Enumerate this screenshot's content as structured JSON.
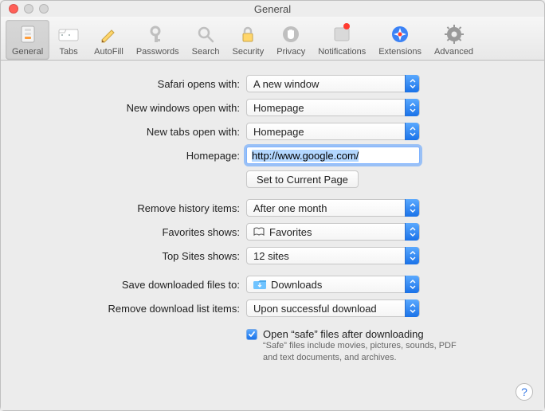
{
  "window": {
    "title": "General"
  },
  "toolbar": {
    "items": [
      {
        "name": "general",
        "label": "General",
        "selected": true
      },
      {
        "name": "tabs",
        "label": "Tabs"
      },
      {
        "name": "autofill",
        "label": "AutoFill"
      },
      {
        "name": "passwords",
        "label": "Passwords"
      },
      {
        "name": "search",
        "label": "Search"
      },
      {
        "name": "security",
        "label": "Security"
      },
      {
        "name": "privacy",
        "label": "Privacy"
      },
      {
        "name": "notifications",
        "label": "Notifications",
        "badge": true
      },
      {
        "name": "extensions",
        "label": "Extensions"
      },
      {
        "name": "advanced",
        "label": "Advanced"
      }
    ]
  },
  "form": {
    "safari_opens_with": {
      "label": "Safari opens with:",
      "value": "A new window"
    },
    "new_windows_open_with": {
      "label": "New windows open with:",
      "value": "Homepage"
    },
    "new_tabs_open_with": {
      "label": "New tabs open with:",
      "value": "Homepage"
    },
    "homepage": {
      "label": "Homepage:",
      "value": "http://www.google.com/"
    },
    "set_current_page": "Set to Current Page",
    "remove_history": {
      "label": "Remove history items:",
      "value": "After one month"
    },
    "favorites_shows": {
      "label": "Favorites shows:",
      "value": "Favorites",
      "icon": "book-open-icon"
    },
    "top_sites_shows": {
      "label": "Top Sites shows:",
      "value": "12 sites"
    },
    "save_downloaded": {
      "label": "Save downloaded files to:",
      "value": "Downloads",
      "icon": "folder-downloads-icon"
    },
    "remove_download_list": {
      "label": "Remove download list items:",
      "value": "Upon successful download"
    },
    "open_safe": {
      "checked": true,
      "label": "Open “safe” files after downloading"
    },
    "open_safe_desc": "“Safe” files include movies, pictures, sounds, PDF and text documents, and archives."
  },
  "help": "?"
}
